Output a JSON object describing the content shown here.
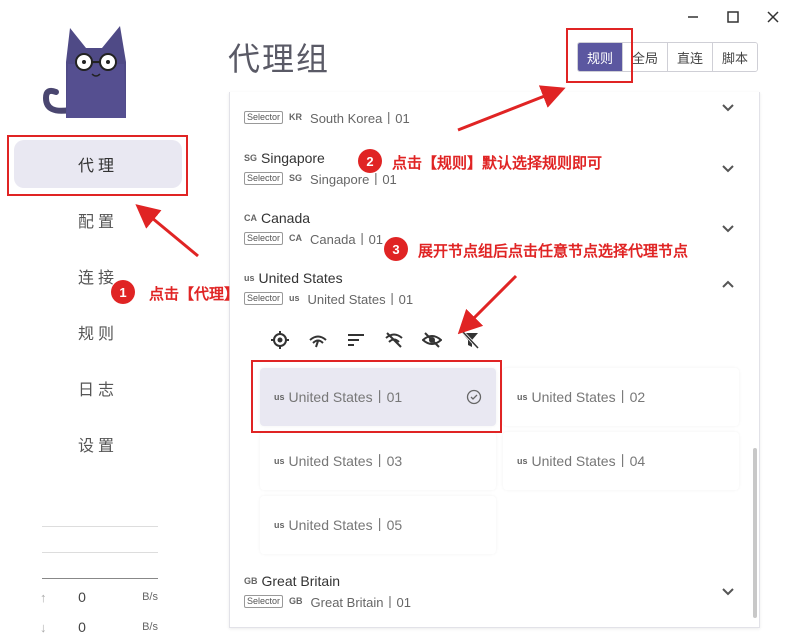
{
  "sidebar": {
    "items": [
      {
        "label": "代理",
        "active": true
      },
      {
        "label": "配置"
      },
      {
        "label": "连接"
      },
      {
        "label": "规则"
      },
      {
        "label": "日志"
      },
      {
        "label": "设置"
      }
    ],
    "traffic": {
      "up": {
        "value": "0",
        "unit": "B/s",
        "icon": "arrow-up-icon"
      },
      "down": {
        "value": "0",
        "unit": "B/s",
        "icon": "arrow-down-icon"
      }
    }
  },
  "header": {
    "title": "代理组",
    "modes": [
      {
        "label": "规则",
        "active": true
      },
      {
        "label": "全局"
      },
      {
        "label": "直连"
      },
      {
        "label": "脚本"
      }
    ]
  },
  "groups": [
    {
      "flag": "",
      "name": "",
      "tag": "Selector",
      "sub_flag": "KR",
      "sub": "South Korea丨01",
      "expanded": false
    },
    {
      "flag": "SG",
      "name": "Singapore",
      "tag": "Selector",
      "sub_flag": "SG",
      "sub": "Singapore丨01",
      "expanded": false
    },
    {
      "flag": "CA",
      "name": "Canada",
      "tag": "Selector",
      "sub_flag": "CA",
      "sub": "Canada丨01",
      "expanded": false
    },
    {
      "flag": "us",
      "name": "United States",
      "tag": "Selector",
      "sub_flag": "us",
      "sub": "United States丨01",
      "expanded": true
    },
    {
      "flag": "GB",
      "name": "Great Britain",
      "tag": "Selector",
      "sub_flag": "GB",
      "sub": "Great Britain丨01",
      "expanded": false
    }
  ],
  "nodes": [
    {
      "flag": "us",
      "label": "United States丨01",
      "selected": true
    },
    {
      "flag": "us",
      "label": "United States丨02"
    },
    {
      "flag": "us",
      "label": "United States丨03"
    },
    {
      "flag": "us",
      "label": "United States丨04"
    },
    {
      "flag": "us",
      "label": "United States丨05"
    }
  ],
  "toolbar_icons": [
    "target-icon",
    "speed-icon",
    "sort-icon",
    "wifi-off-icon",
    "eye-off-icon",
    "filter-off-icon"
  ],
  "annotations": {
    "step1": {
      "num": "1",
      "text": "点击【代理】"
    },
    "step2": {
      "num": "2",
      "text": "点击【规则】默认选择规则即可"
    },
    "step3": {
      "num": "3",
      "text": "展开节点组后点击任意节点选择代理节点"
    }
  },
  "colors": {
    "accent": "#5b57a0",
    "annotation": "#e02424",
    "active_bg": "#e9e8f2"
  }
}
